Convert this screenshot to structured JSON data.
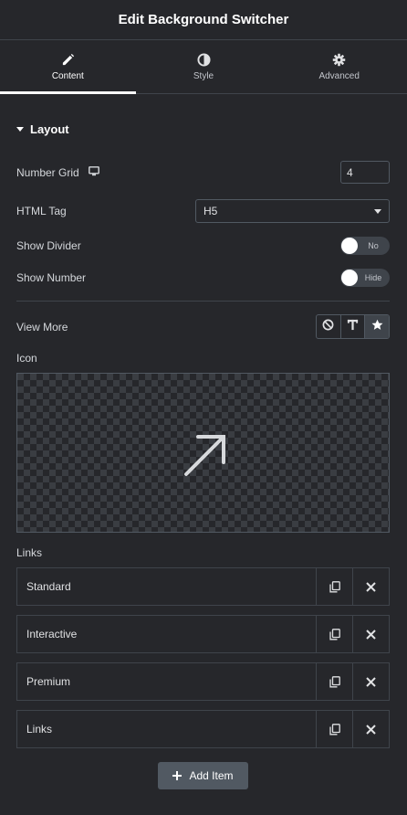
{
  "header": {
    "title": "Edit Background Switcher"
  },
  "tabs": [
    {
      "label": "Content",
      "icon": "pencil-icon",
      "active": true
    },
    {
      "label": "Style",
      "icon": "contrast-icon",
      "active": false
    },
    {
      "label": "Advanced",
      "icon": "gear-icon",
      "active": false
    }
  ],
  "section": {
    "title": "Layout"
  },
  "controls": {
    "number_grid": {
      "label": "Number Grid",
      "value": "4"
    },
    "html_tag": {
      "label": "HTML Tag",
      "value": "H5"
    },
    "show_divider": {
      "label": "Show Divider",
      "state": "No"
    },
    "show_number": {
      "label": "Show Number",
      "state": "Hide"
    },
    "view_more": {
      "label": "View More",
      "options": [
        "none-icon",
        "text-icon",
        "star-icon"
      ],
      "selected": "star-icon"
    },
    "icon": {
      "label": "Icon",
      "preview_icon": "arrow-up-right-icon"
    }
  },
  "links": {
    "label": "Links",
    "items": [
      {
        "title": "Standard"
      },
      {
        "title": "Interactive"
      },
      {
        "title": "Premium"
      },
      {
        "title": "Links"
      }
    ],
    "add_label": "Add Item"
  },
  "colors": {
    "background": "#26272b",
    "border": "#3f444b",
    "button": "#515962",
    "text": "#e0e1e3"
  }
}
